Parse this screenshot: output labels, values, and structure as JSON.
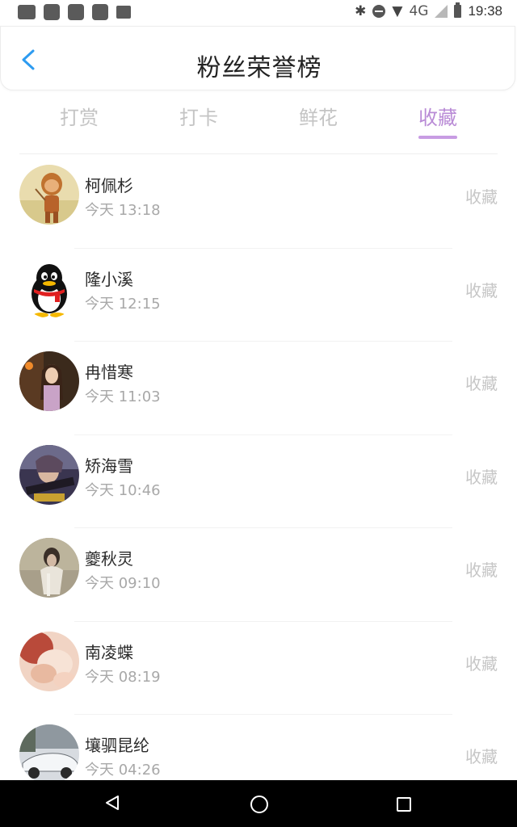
{
  "status_bar": {
    "network": "4G",
    "time": "19:38"
  },
  "header": {
    "title": "粉丝荣誉榜"
  },
  "tabs": [
    {
      "label": "打赏",
      "active": false
    },
    {
      "label": "打卡",
      "active": false
    },
    {
      "label": "鲜花",
      "active": false
    },
    {
      "label": "收藏",
      "active": true
    }
  ],
  "fans": [
    {
      "name": "柯佩杉",
      "time": "今天 13:18",
      "action": "收藏"
    },
    {
      "name": "隆小溪",
      "time": "今天 12:15",
      "action": "收藏"
    },
    {
      "name": "冉惜寒",
      "time": "今天 11:03",
      "action": "收藏"
    },
    {
      "name": "矫海雪",
      "time": "今天 10:46",
      "action": "收藏"
    },
    {
      "name": "夔秋灵",
      "time": "今天 09:10",
      "action": "收藏"
    },
    {
      "name": "南凌蝶",
      "time": "今天 08:19",
      "action": "收藏"
    },
    {
      "name": "壤驷昆纶",
      "time": "今天 04:26",
      "action": "收藏"
    }
  ],
  "colors": {
    "accent": "#b98bd6",
    "back_arrow": "#2d9bf0"
  }
}
